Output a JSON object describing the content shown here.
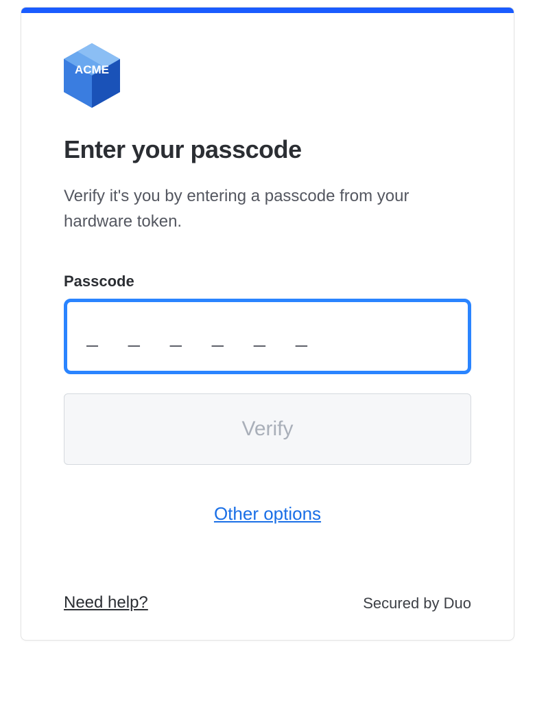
{
  "logo": {
    "text": "ACME"
  },
  "heading": "Enter your passcode",
  "subtitle": "Verify it's you by entering a passcode from your hardware token.",
  "field": {
    "label": "Passcode",
    "placeholder": "_ _ _ _ _ _",
    "value": ""
  },
  "verify_button": "Verify",
  "other_options": "Other options",
  "footer": {
    "help": "Need help?",
    "secured": "Secured by Duo"
  },
  "colors": {
    "accent": "#1a5cff",
    "focus_border": "#2a84ff",
    "link": "#1a6fe6"
  }
}
